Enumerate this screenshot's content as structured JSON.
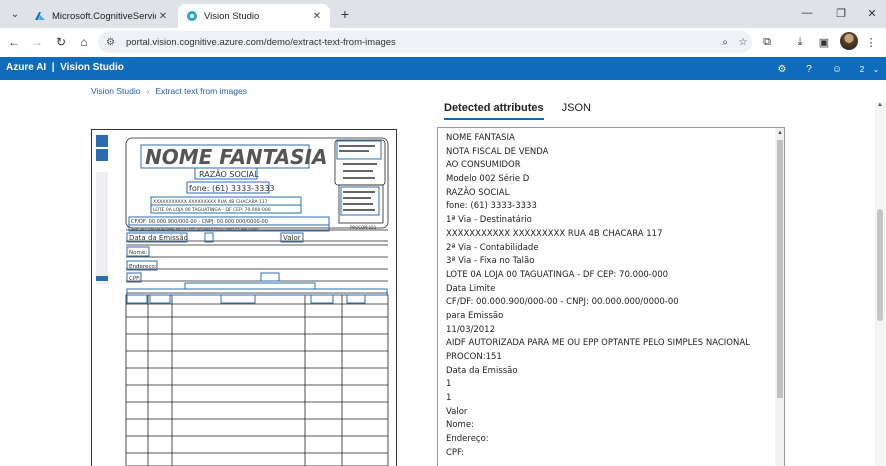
{
  "browser": {
    "tabs": [
      {
        "title": "Microsoft.CognitiveServicesAll",
        "active": false
      },
      {
        "title": "Vision Studio",
        "active": true
      }
    ],
    "url": "portal.vision.cognitive.azure.com/demo/extract-text-from-images"
  },
  "header": {
    "brand": "Azure AI",
    "product": "Vision Studio",
    "notification_count": "2"
  },
  "breadcrumb": [
    "Vision Studio",
    "Extract text from images"
  ],
  "result_tabs": [
    "Detected attributes",
    "JSON"
  ],
  "detected_lines": [
    "NOME FANTASIA",
    "NOTA FISCAL DE VENDA",
    "AO CONSUMIDOR",
    "Modelo 002 Série D",
    "RAZÃO SOCIAL",
    "fone: (61) 3333-3333",
    "1ª Via - Destinatário",
    "XXXXXXXXXXX XXXXXXXXX RUA 4B CHACARA 117",
    "2ª Via - Contabilidade",
    "3ª Via - Fixa no Talão",
    "LOTE 0A LOJA 00 TAGUATINGA - DF CEP: 70.000-000",
    "Data Limite",
    "CF/DF: 00.000.900/000-00 - CNPJ: 00.000.000/0000-00",
    "para Emissão",
    "11/03/2012",
    "AIDF AUTORIZADA PARA ME OU EPP OPTANTE PELO SIMPLES NACIONAL",
    "PROCON:151",
    "Data da Emissão",
    "1",
    "1",
    "Valor",
    "Nome:",
    "Endereço:",
    "CPF:"
  ],
  "document": {
    "title": "NOME FANTASIA",
    "company": "RAZÃO SOCIAL",
    "phone": "fone: (61) 3333-3333",
    "address_line": "XXXXXXXXXXX XXXXXXXXX RUA 4B CHACARA 117",
    "address_line2": "LOTE 0A LOJA 00 TAGUATINGA - DF CEP: 70.000-000",
    "cnpj_line": "CF/DF: 00.000.900/000-00 - CNPJ: 00.000.000/0000-00",
    "aidf_line": "AIDF AUTORIZADA PARA ME OU EPP OPTANTE PELO SIMPLES NACIONAL",
    "procon": "PROCON:151",
    "date_label": "Data da Emissão",
    "value_label": "Valor",
    "name_label": "Nome:",
    "address_label": "Endereço:",
    "cpf_label": "CPF:"
  },
  "colors": {
    "accent": "#0f6cbd",
    "ocr_box": "#2b6cb0"
  }
}
